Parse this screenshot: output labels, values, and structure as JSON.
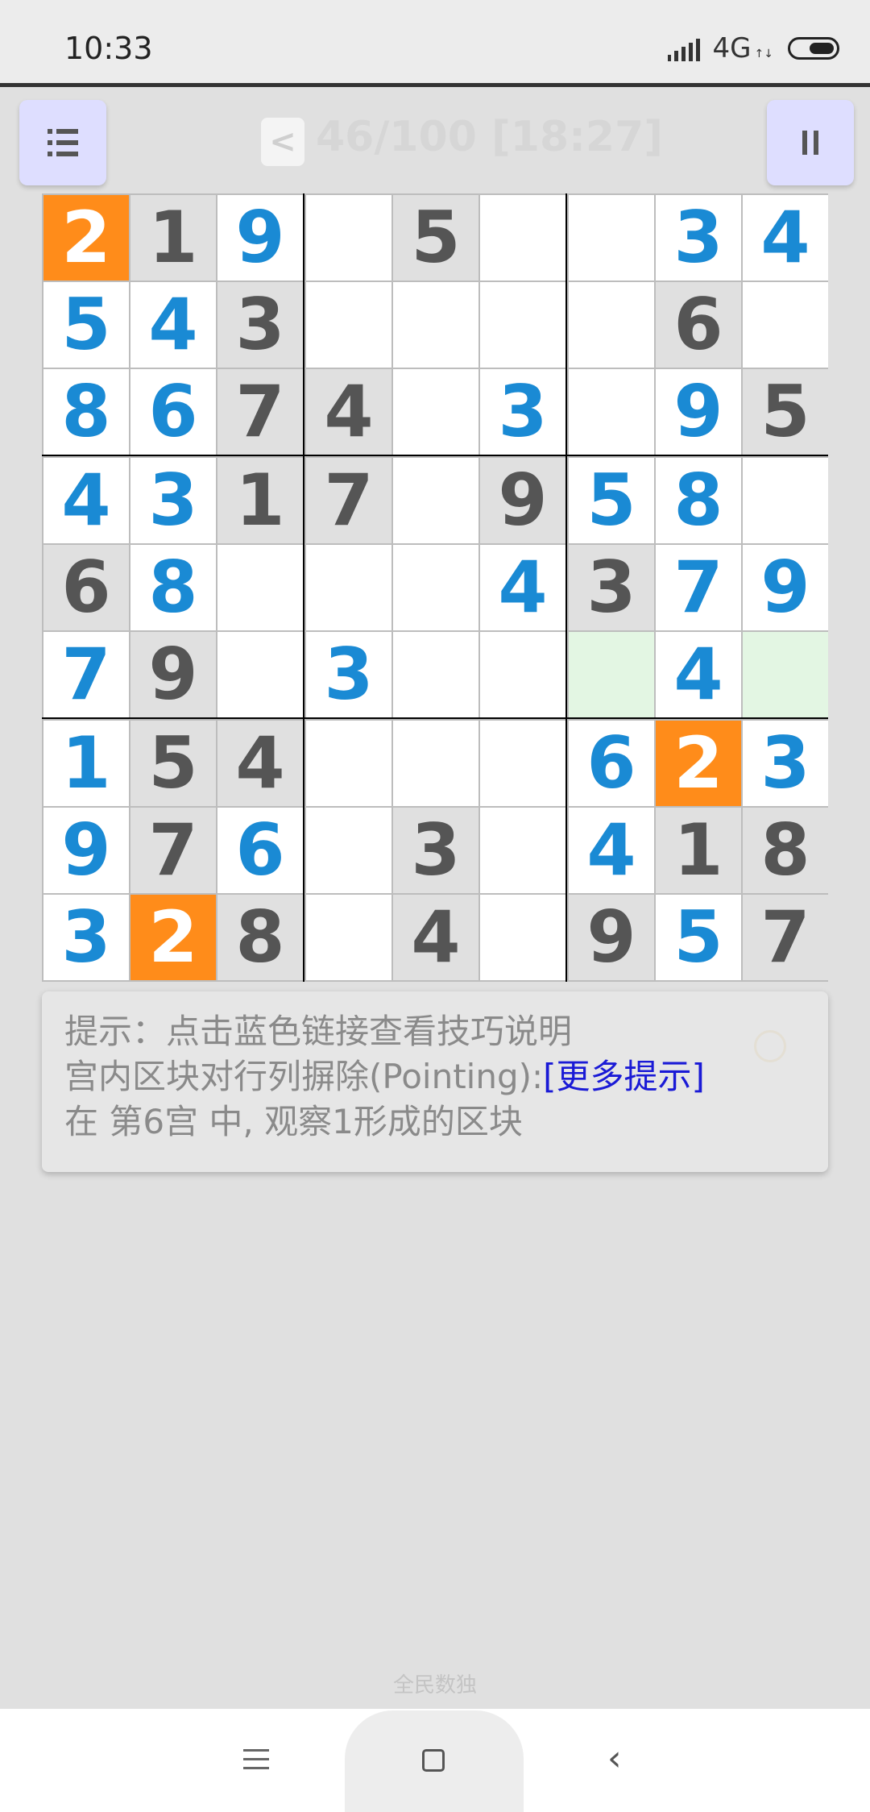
{
  "status_bar": {
    "time": "10:33",
    "network": "4G",
    "network_arrows": "↑↓",
    "icons": [
      "signal-icon",
      "battery-icon"
    ]
  },
  "header": {
    "menu_icon": "menu-icon",
    "back_label": "<",
    "progress": "46/100 [18:27]",
    "pause_icon": "pause-icon"
  },
  "colors": {
    "given": "#555555",
    "entered": "#1a8ad4",
    "highlight_bg": "#ff8c1a",
    "highlight_fg": "#ffffff",
    "given_bg": "#e0e0e0",
    "empty_bg": "#ffffff",
    "candidate_bg": "#e3f6e3"
  },
  "board": {
    "rows": [
      [
        {
          "v": "2",
          "t": "hl"
        },
        {
          "v": "1",
          "t": "g"
        },
        {
          "v": "9",
          "t": "u"
        },
        {
          "v": "",
          "t": "e"
        },
        {
          "v": "5",
          "t": "g"
        },
        {
          "v": "",
          "t": "e"
        },
        {
          "v": "",
          "t": "e"
        },
        {
          "v": "3",
          "t": "u"
        },
        {
          "v": "4",
          "t": "u"
        }
      ],
      [
        {
          "v": "5",
          "t": "u"
        },
        {
          "v": "4",
          "t": "u"
        },
        {
          "v": "3",
          "t": "g"
        },
        {
          "v": "",
          "t": "e"
        },
        {
          "v": "",
          "t": "e"
        },
        {
          "v": "",
          "t": "e"
        },
        {
          "v": "",
          "t": "e"
        },
        {
          "v": "6",
          "t": "g"
        },
        {
          "v": "",
          "t": "e"
        }
      ],
      [
        {
          "v": "8",
          "t": "u"
        },
        {
          "v": "6",
          "t": "u"
        },
        {
          "v": "7",
          "t": "g"
        },
        {
          "v": "4",
          "t": "g"
        },
        {
          "v": "",
          "t": "e"
        },
        {
          "v": "3",
          "t": "u"
        },
        {
          "v": "",
          "t": "e"
        },
        {
          "v": "9",
          "t": "u"
        },
        {
          "v": "5",
          "t": "g"
        }
      ],
      [
        {
          "v": "4",
          "t": "u"
        },
        {
          "v": "3",
          "t": "u"
        },
        {
          "v": "1",
          "t": "g"
        },
        {
          "v": "7",
          "t": "g"
        },
        {
          "v": "",
          "t": "e"
        },
        {
          "v": "9",
          "t": "g"
        },
        {
          "v": "5",
          "t": "u"
        },
        {
          "v": "8",
          "t": "u"
        },
        {
          "v": "",
          "t": "e"
        }
      ],
      [
        {
          "v": "6",
          "t": "g"
        },
        {
          "v": "8",
          "t": "u"
        },
        {
          "v": "",
          "t": "e"
        },
        {
          "v": "",
          "t": "e"
        },
        {
          "v": "",
          "t": "e"
        },
        {
          "v": "4",
          "t": "u"
        },
        {
          "v": "3",
          "t": "g"
        },
        {
          "v": "7",
          "t": "u"
        },
        {
          "v": "9",
          "t": "u"
        }
      ],
      [
        {
          "v": "7",
          "t": "u"
        },
        {
          "v": "9",
          "t": "g"
        },
        {
          "v": "",
          "t": "e"
        },
        {
          "v": "3",
          "t": "u"
        },
        {
          "v": "",
          "t": "e"
        },
        {
          "v": "",
          "t": "e"
        },
        {
          "v": "",
          "t": "c"
        },
        {
          "v": "4",
          "t": "u"
        },
        {
          "v": "",
          "t": "c"
        }
      ],
      [
        {
          "v": "1",
          "t": "u"
        },
        {
          "v": "5",
          "t": "g"
        },
        {
          "v": "4",
          "t": "g"
        },
        {
          "v": "",
          "t": "e"
        },
        {
          "v": "",
          "t": "e"
        },
        {
          "v": "",
          "t": "e"
        },
        {
          "v": "6",
          "t": "u"
        },
        {
          "v": "2",
          "t": "hl"
        },
        {
          "v": "3",
          "t": "u"
        }
      ],
      [
        {
          "v": "9",
          "t": "u"
        },
        {
          "v": "7",
          "t": "g"
        },
        {
          "v": "6",
          "t": "u"
        },
        {
          "v": "",
          "t": "e"
        },
        {
          "v": "3",
          "t": "g"
        },
        {
          "v": "",
          "t": "e"
        },
        {
          "v": "4",
          "t": "u"
        },
        {
          "v": "1",
          "t": "g"
        },
        {
          "v": "8",
          "t": "g"
        }
      ],
      [
        {
          "v": "3",
          "t": "u"
        },
        {
          "v": "2",
          "t": "hl"
        },
        {
          "v": "8",
          "t": "g"
        },
        {
          "v": "",
          "t": "e"
        },
        {
          "v": "4",
          "t": "g"
        },
        {
          "v": "",
          "t": "e"
        },
        {
          "v": "9",
          "t": "g"
        },
        {
          "v": "5",
          "t": "u"
        },
        {
          "v": "7",
          "t": "g"
        }
      ]
    ]
  },
  "hint": {
    "line1": "提示：点击蓝色链接查看技巧说明",
    "line2_text": "宫内区块对行列摒除(Pointing):",
    "line2_link": "[更多提示]",
    "line3": "在 第6宫 中, 观察1形成的区块",
    "bulb_icon": "lightbulb-icon"
  },
  "footer": {
    "app_name": "全民数独",
    "nav_icons": [
      "nav-menu-icon",
      "nav-home-icon",
      "nav-back-icon"
    ],
    "nav_back_glyph": "‹"
  }
}
